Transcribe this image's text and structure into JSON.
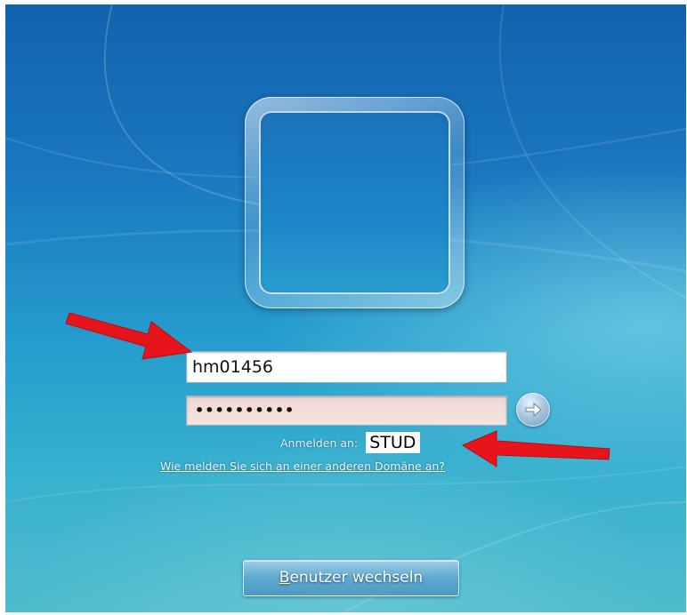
{
  "login": {
    "username_value": "hm01456",
    "password_mask": "••••••••••",
    "domain_label": "Anmelden an:",
    "domain_value": "STUD",
    "other_domain_link": "Wie melden Sie sich an einer anderen Domäne an?",
    "switch_user_mnemonic": "B",
    "switch_user_rest": "enutzer wechseln"
  },
  "icons": {
    "avatar": "user-picture-frame-icon",
    "go": "arrow-right-icon",
    "annotation": "red-arrow-icon"
  },
  "colors": {
    "annotation_red": "#e8141b",
    "background_blue": "#1a78bf",
    "password_field_tint": "#efd6d3"
  }
}
